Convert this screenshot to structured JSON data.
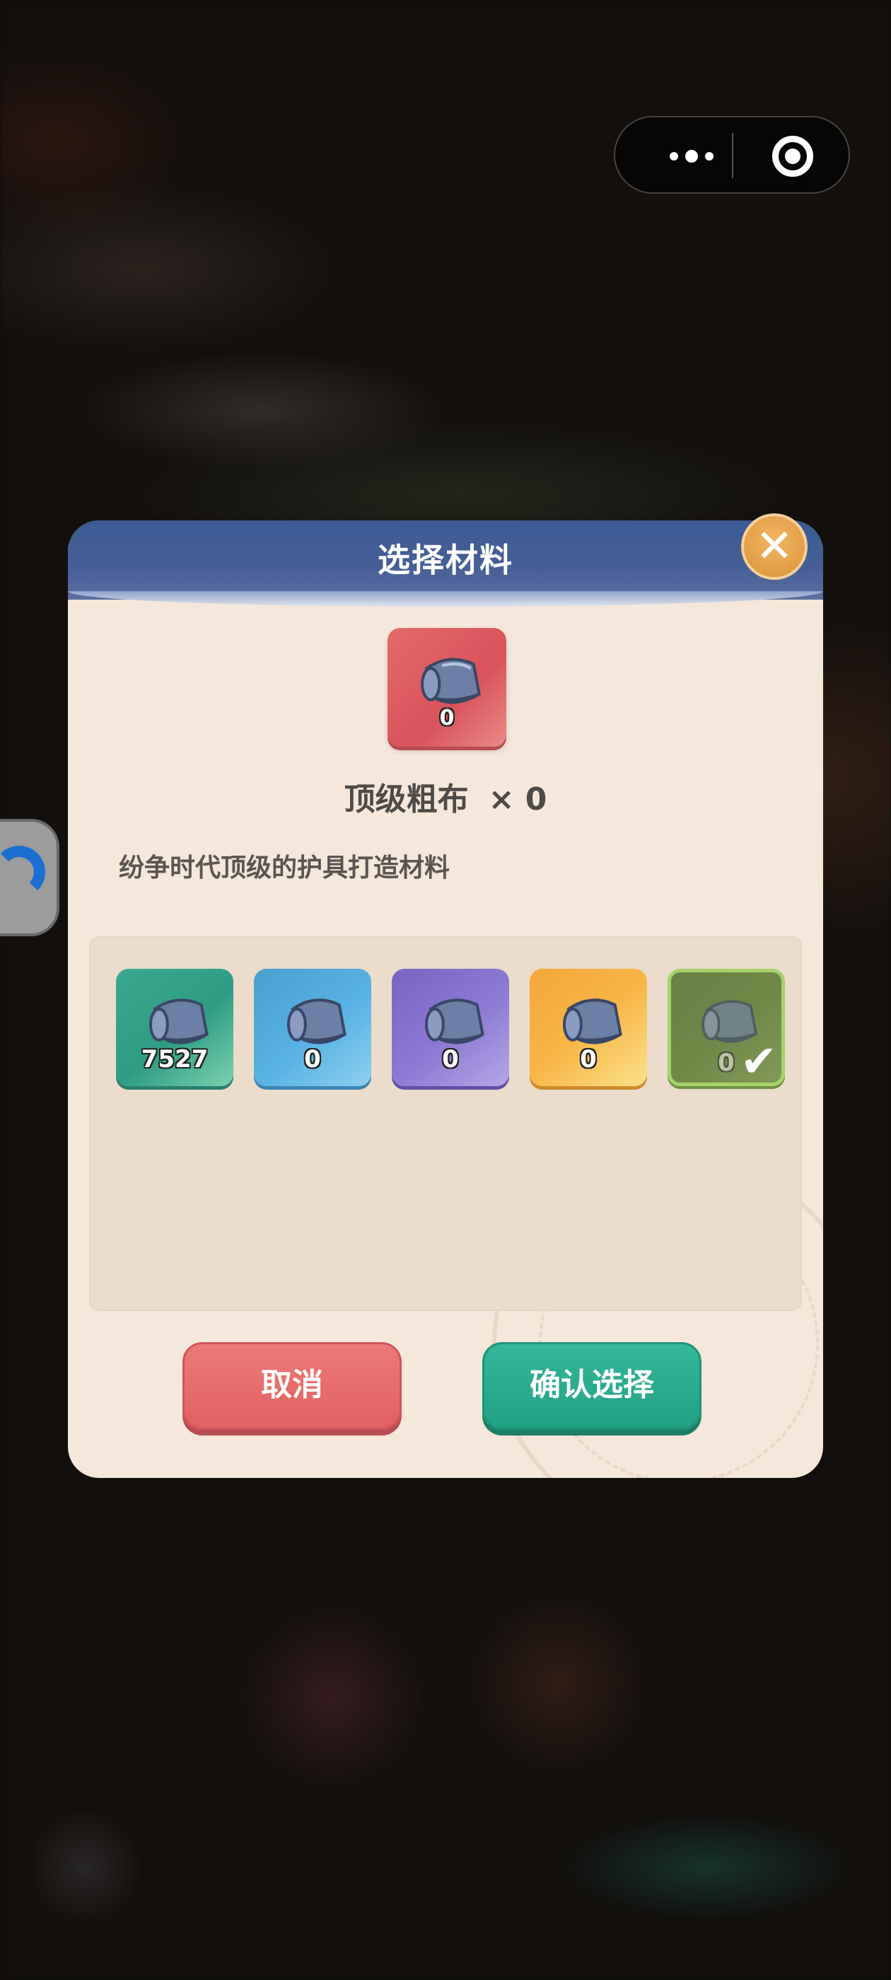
{
  "capsule": {
    "more_icon": "more-dots-icon",
    "close_icon": "target-circle-icon"
  },
  "dialog": {
    "title": "选择材料",
    "close_icon": "close-icon",
    "close_glyph": "✕",
    "selected_item": {
      "icon": "cloth-roll-icon",
      "count": "0",
      "name": "顶级粗布",
      "quantity": "× 0",
      "description": "纷争时代顶级的护具打造材料"
    },
    "slots": [
      {
        "icon": "cloth-roll-icon",
        "count": "7527",
        "color": "#3aa88e"
      },
      {
        "icon": "cloth-roll-icon",
        "count": "0",
        "color": "#58b2e3"
      },
      {
        "icon": "cloth-roll-icon",
        "count": "0",
        "color": "#8d7ad3"
      },
      {
        "icon": "cloth-roll-icon",
        "count": "0",
        "color": "#f7b645"
      },
      {
        "icon": "cloth-roll-icon",
        "count": "0",
        "color": "#d9535a",
        "selected": true,
        "check_glyph": "✔"
      }
    ],
    "buttons": {
      "cancel": "取消",
      "confirm": "确认选择"
    }
  },
  "colors": {
    "header": "#3b5b93",
    "panel": "#f5e7da",
    "cancel": "#e1615f",
    "confirm": "#21a184",
    "close": "#d99339"
  }
}
